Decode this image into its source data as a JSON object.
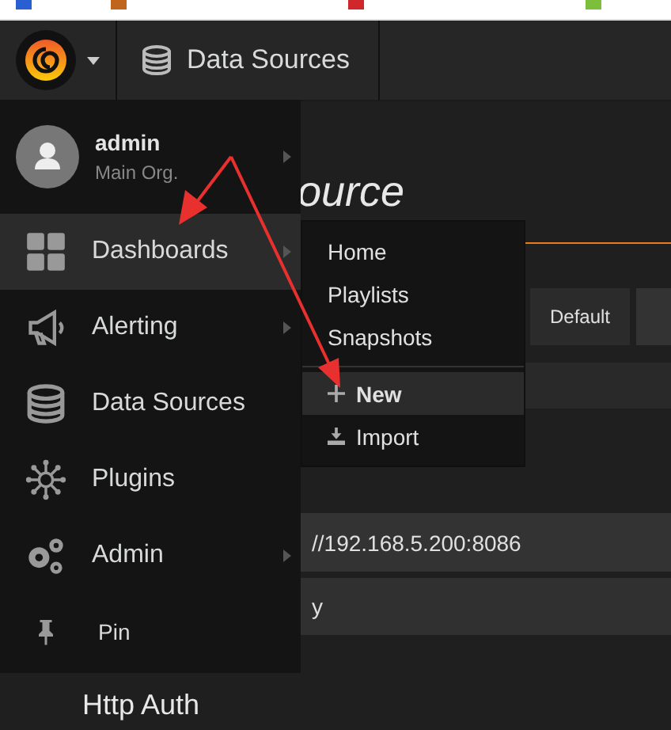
{
  "top_nav": {
    "title": "Data Sources"
  },
  "side_menu": {
    "user": {
      "name": "admin",
      "org": "Main Org.",
      "arrow": true
    },
    "items": [
      {
        "label": "Dashboards",
        "kind": "grid",
        "selected": true,
        "arrow": true
      },
      {
        "label": "Alerting",
        "kind": "megaphone",
        "selected": false,
        "arrow": true
      },
      {
        "label": "Data Sources",
        "kind": "database",
        "selected": false,
        "arrow": false
      },
      {
        "label": "Plugins",
        "kind": "plugins",
        "selected": false,
        "arrow": false
      },
      {
        "label": "Admin",
        "kind": "gears",
        "selected": false,
        "arrow": true
      },
      {
        "label": "Pin",
        "kind": "pin",
        "selected": false,
        "arrow": false
      }
    ]
  },
  "submenu": {
    "items": [
      {
        "label": "Home",
        "kind": "link",
        "selected": false
      },
      {
        "label": "Playlists",
        "kind": "link",
        "selected": false
      },
      {
        "label": "Snapshots",
        "kind": "link",
        "selected": false
      },
      {
        "label": "New",
        "kind": "new",
        "selected": true
      },
      {
        "label": "Import",
        "kind": "import",
        "selected": false
      }
    ]
  },
  "page": {
    "heading": "ource",
    "default_button": "Default",
    "url_value": "//192.168.5.200:8086",
    "access_value": "y",
    "section_heading": "Http Auth"
  }
}
